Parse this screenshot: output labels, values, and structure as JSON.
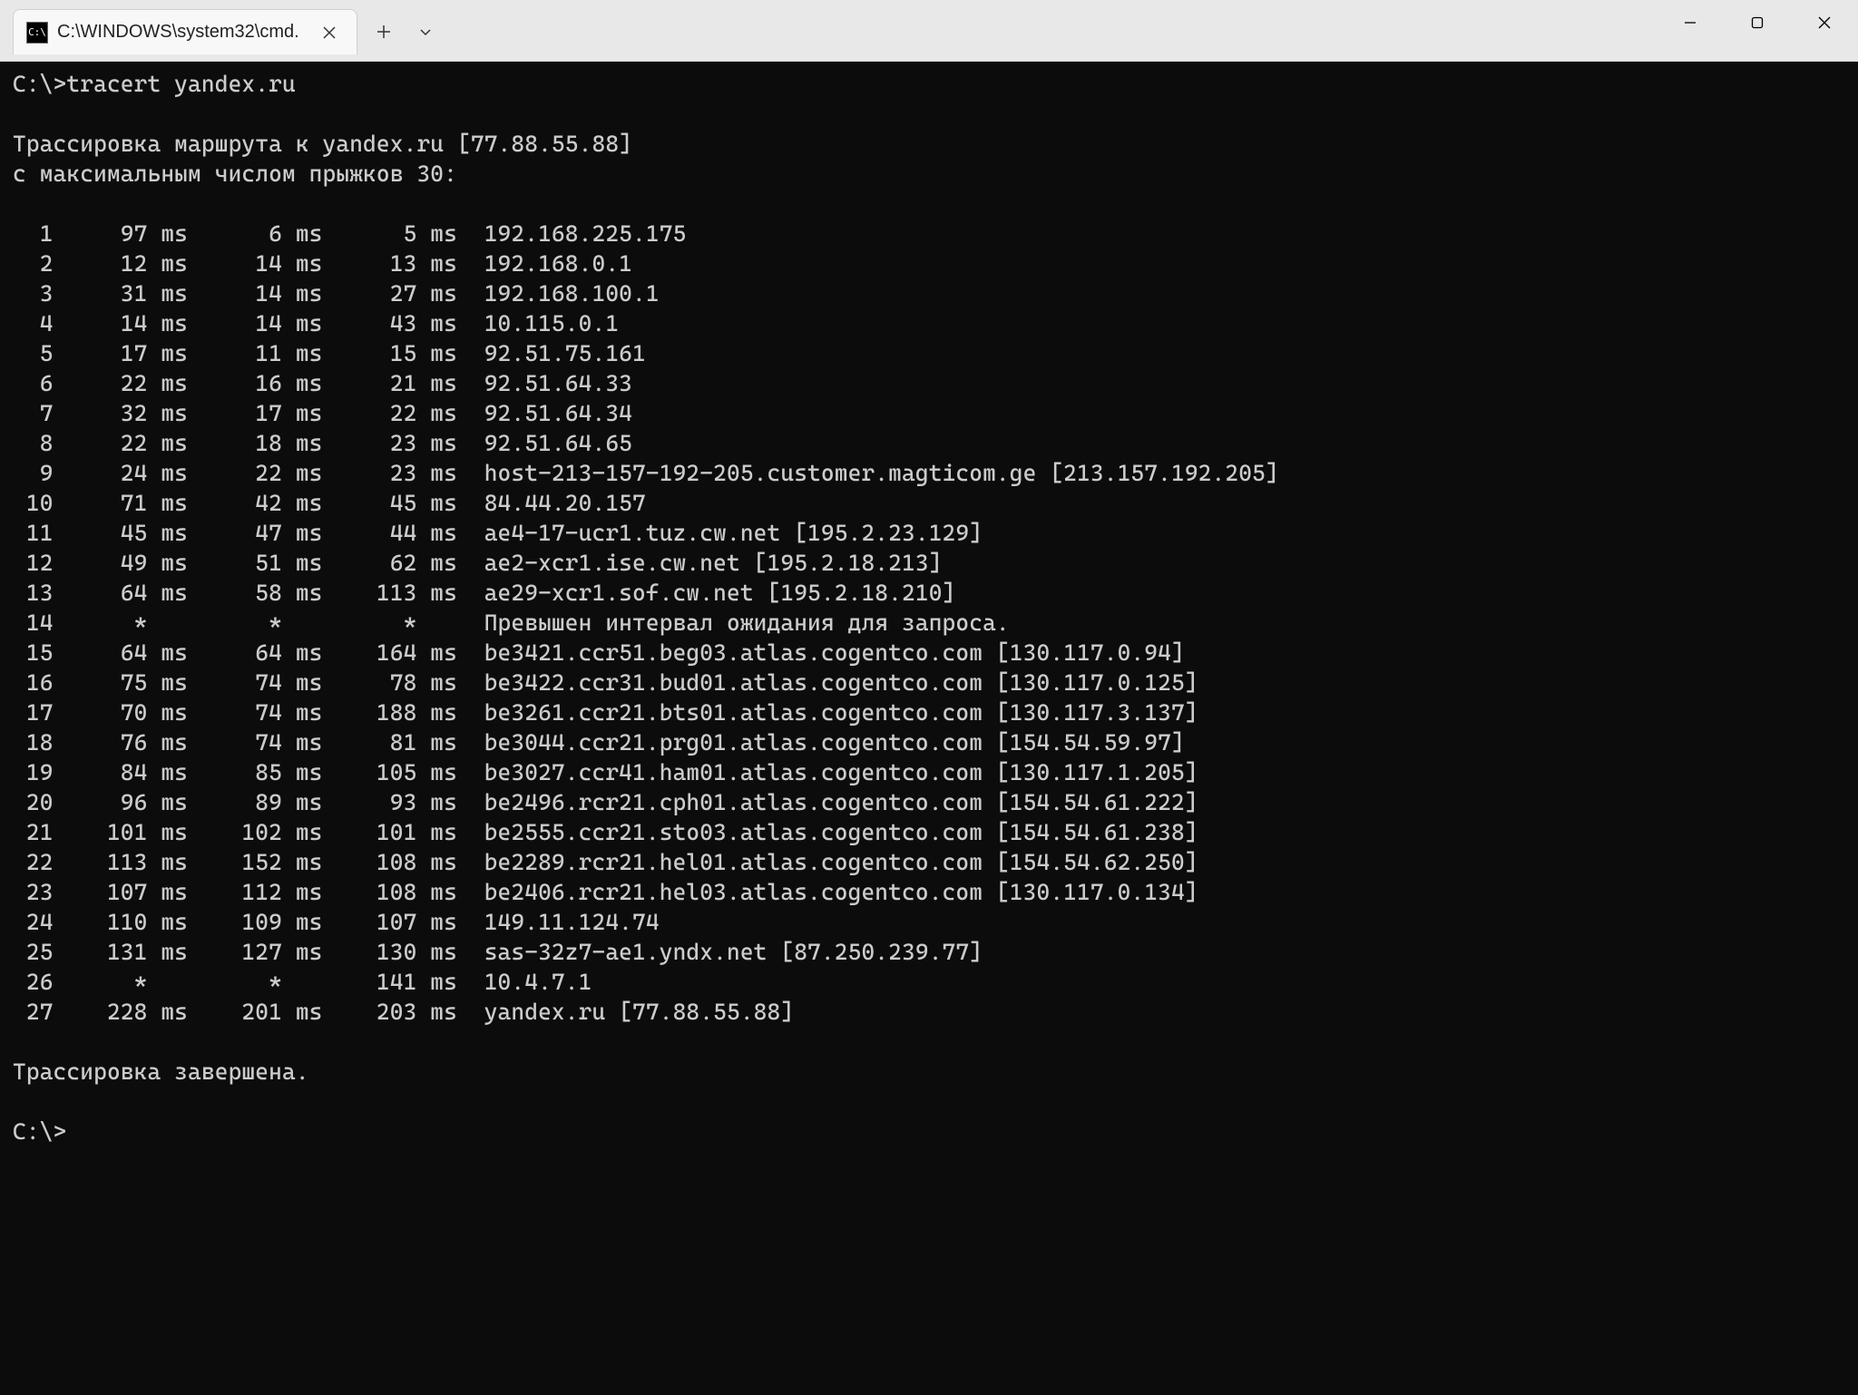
{
  "window": {
    "tab_title": "C:\\WINDOWS\\system32\\cmd."
  },
  "terminal": {
    "prompt1": "C:\\>",
    "command": "tracert yandex.ru",
    "header1": "Трассировка маршрута к yandex.ru [77.88.55.88]",
    "header2": "с максимальным числом прыжков 30:",
    "hops": [
      {
        "n": "1",
        "t1": "97 ms",
        "t2": "6 ms",
        "t3": "5 ms",
        "host": "192.168.225.175"
      },
      {
        "n": "2",
        "t1": "12 ms",
        "t2": "14 ms",
        "t3": "13 ms",
        "host": "192.168.0.1"
      },
      {
        "n": "3",
        "t1": "31 ms",
        "t2": "14 ms",
        "t3": "27 ms",
        "host": "192.168.100.1"
      },
      {
        "n": "4",
        "t1": "14 ms",
        "t2": "14 ms",
        "t3": "43 ms",
        "host": "10.115.0.1"
      },
      {
        "n": "5",
        "t1": "17 ms",
        "t2": "11 ms",
        "t3": "15 ms",
        "host": "92.51.75.161"
      },
      {
        "n": "6",
        "t1": "22 ms",
        "t2": "16 ms",
        "t3": "21 ms",
        "host": "92.51.64.33"
      },
      {
        "n": "7",
        "t1": "32 ms",
        "t2": "17 ms",
        "t3": "22 ms",
        "host": "92.51.64.34"
      },
      {
        "n": "8",
        "t1": "22 ms",
        "t2": "18 ms",
        "t3": "23 ms",
        "host": "92.51.64.65"
      },
      {
        "n": "9",
        "t1": "24 ms",
        "t2": "22 ms",
        "t3": "23 ms",
        "host": "host-213-157-192-205.customer.magticom.ge [213.157.192.205]"
      },
      {
        "n": "10",
        "t1": "71 ms",
        "t2": "42 ms",
        "t3": "45 ms",
        "host": "84.44.20.157"
      },
      {
        "n": "11",
        "t1": "45 ms",
        "t2": "47 ms",
        "t3": "44 ms",
        "host": "ae4-17-ucr1.tuz.cw.net [195.2.23.129]"
      },
      {
        "n": "12",
        "t1": "49 ms",
        "t2": "51 ms",
        "t3": "62 ms",
        "host": "ae2-xcr1.ise.cw.net [195.2.18.213]"
      },
      {
        "n": "13",
        "t1": "64 ms",
        "t2": "58 ms",
        "t3": "113 ms",
        "host": "ae29-xcr1.sof.cw.net [195.2.18.210]"
      },
      {
        "n": "14",
        "t1": "*",
        "t2": "*",
        "t3": "*",
        "host": "Превышен интервал ожидания для запроса."
      },
      {
        "n": "15",
        "t1": "64 ms",
        "t2": "64 ms",
        "t3": "164 ms",
        "host": "be3421.ccr51.beg03.atlas.cogentco.com [130.117.0.94]"
      },
      {
        "n": "16",
        "t1": "75 ms",
        "t2": "74 ms",
        "t3": "78 ms",
        "host": "be3422.ccr31.bud01.atlas.cogentco.com [130.117.0.125]"
      },
      {
        "n": "17",
        "t1": "70 ms",
        "t2": "74 ms",
        "t3": "188 ms",
        "host": "be3261.ccr21.bts01.atlas.cogentco.com [130.117.3.137]"
      },
      {
        "n": "18",
        "t1": "76 ms",
        "t2": "74 ms",
        "t3": "81 ms",
        "host": "be3044.ccr21.prg01.atlas.cogentco.com [154.54.59.97]"
      },
      {
        "n": "19",
        "t1": "84 ms",
        "t2": "85 ms",
        "t3": "105 ms",
        "host": "be3027.ccr41.ham01.atlas.cogentco.com [130.117.1.205]"
      },
      {
        "n": "20",
        "t1": "96 ms",
        "t2": "89 ms",
        "t3": "93 ms",
        "host": "be2496.rcr21.cph01.atlas.cogentco.com [154.54.61.222]"
      },
      {
        "n": "21",
        "t1": "101 ms",
        "t2": "102 ms",
        "t3": "101 ms",
        "host": "be2555.ccr21.sto03.atlas.cogentco.com [154.54.61.238]"
      },
      {
        "n": "22",
        "t1": "113 ms",
        "t2": "152 ms",
        "t3": "108 ms",
        "host": "be2289.rcr21.hel01.atlas.cogentco.com [154.54.62.250]"
      },
      {
        "n": "23",
        "t1": "107 ms",
        "t2": "112 ms",
        "t3": "108 ms",
        "host": "be2406.rcr21.hel03.atlas.cogentco.com [130.117.0.134]"
      },
      {
        "n": "24",
        "t1": "110 ms",
        "t2": "109 ms",
        "t3": "107 ms",
        "host": "149.11.124.74"
      },
      {
        "n": "25",
        "t1": "131 ms",
        "t2": "127 ms",
        "t3": "130 ms",
        "host": "sas-32z7-ae1.yndx.net [87.250.239.77]"
      },
      {
        "n": "26",
        "t1": "*",
        "t2": "*",
        "t3": "141 ms",
        "host": "10.4.7.1"
      },
      {
        "n": "27",
        "t1": "228 ms",
        "t2": "201 ms",
        "t3": "203 ms",
        "host": "yandex.ru [77.88.55.88]"
      }
    ],
    "footer": "Трассировка завершена.",
    "prompt2": "C:\\>"
  }
}
